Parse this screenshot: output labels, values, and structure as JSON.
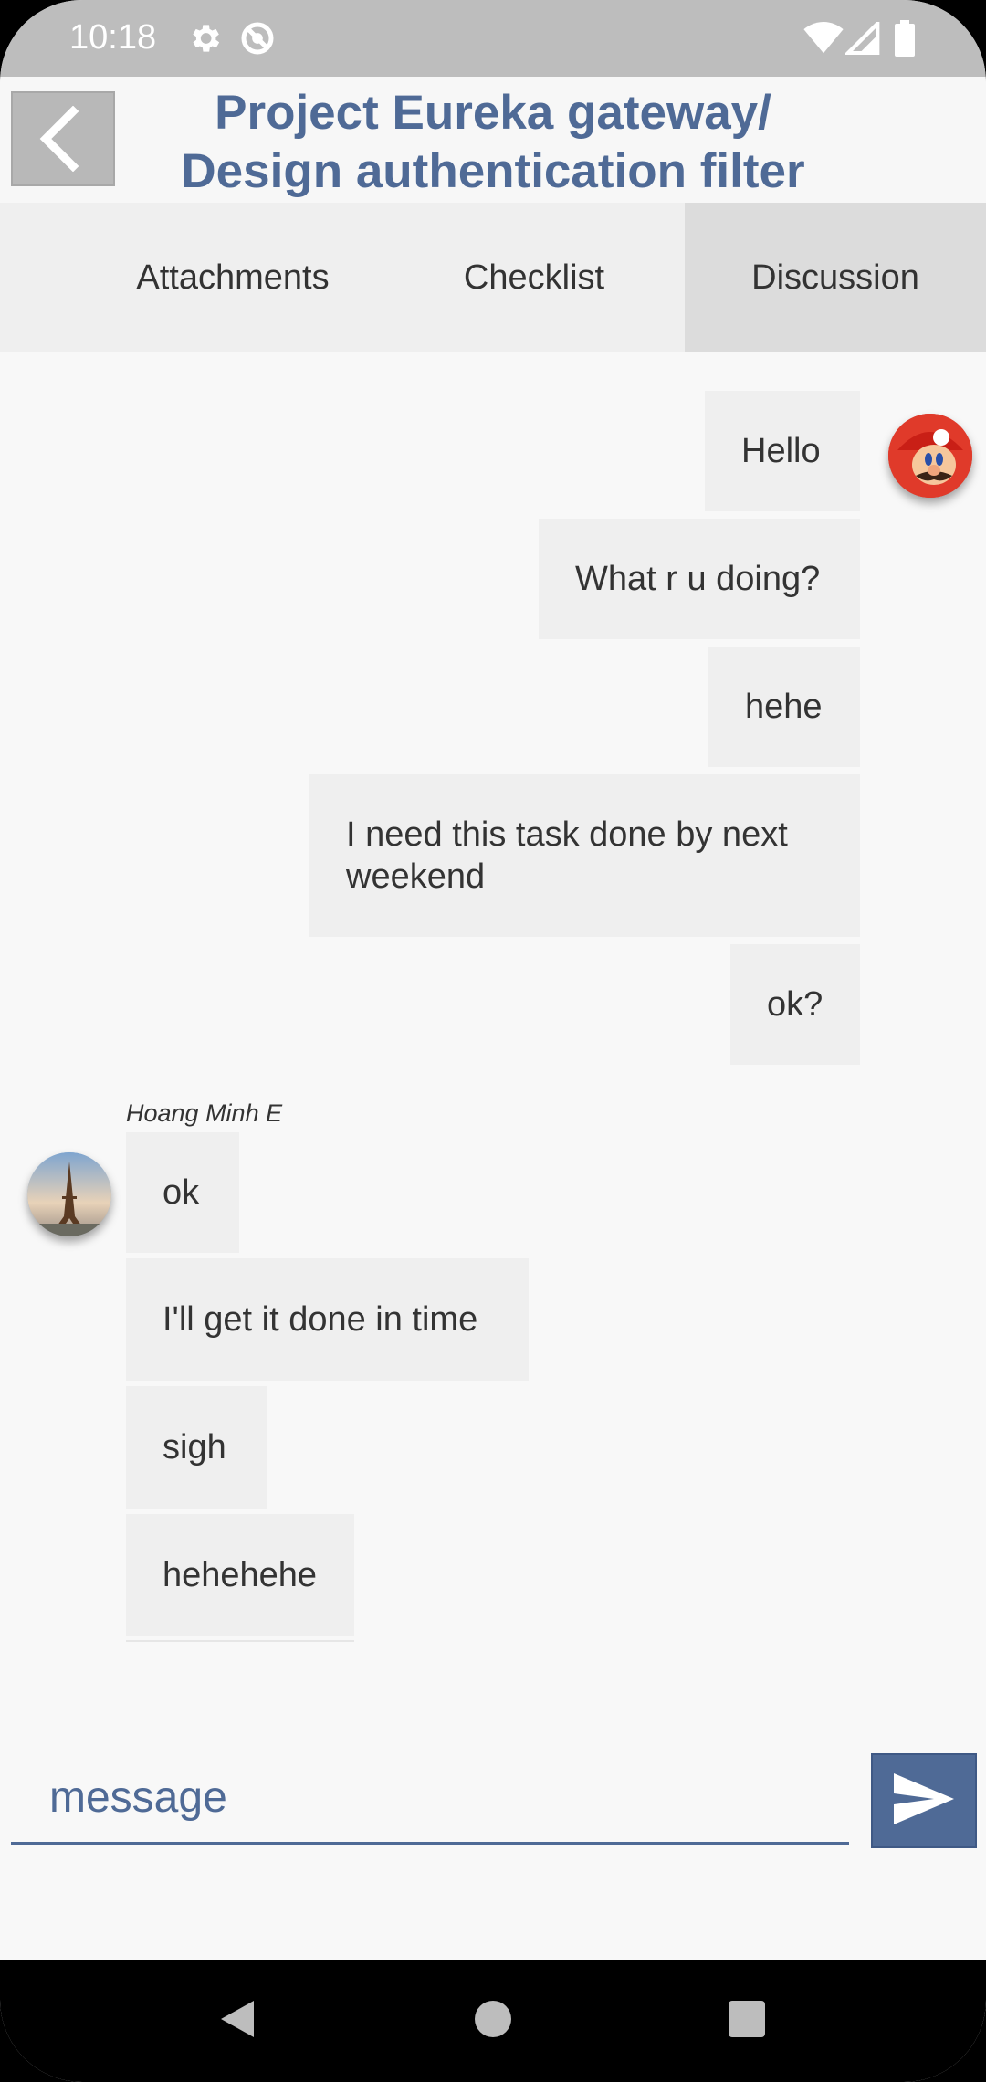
{
  "status_bar": {
    "time": "10:18",
    "icons": [
      "gear-icon",
      "sync-disabled-icon",
      "wifi-icon",
      "signal-icon",
      "battery-icon"
    ]
  },
  "header": {
    "title_line1": "Project Eureka gateway/",
    "title_line2": "Design authentication filter",
    "back_icon": "chevron-left-icon"
  },
  "tabs": [
    {
      "label": "Attachments",
      "active": false
    },
    {
      "label": "Checklist",
      "active": false
    },
    {
      "label": "Discussion",
      "active": true
    }
  ],
  "discussion": {
    "outgoing": [
      {
        "text": "Hello"
      },
      {
        "text": "What r u doing?"
      },
      {
        "text": "hehe"
      },
      {
        "text": "I need this task done by next weekend"
      },
      {
        "text": "ok?"
      }
    ],
    "incoming_sender": "Hoang Minh E",
    "incoming": [
      {
        "text": "ok"
      },
      {
        "text": "I'll get it done in time"
      },
      {
        "text": "sigh"
      },
      {
        "text": "hehehehe"
      }
    ]
  },
  "composer": {
    "placeholder": "message",
    "send_icon": "send-icon"
  },
  "colors": {
    "accent": "#4f6a96",
    "bubble": "#efefef",
    "tab_active": "#dcdcdc",
    "status_bar": "#bdbdbd"
  }
}
